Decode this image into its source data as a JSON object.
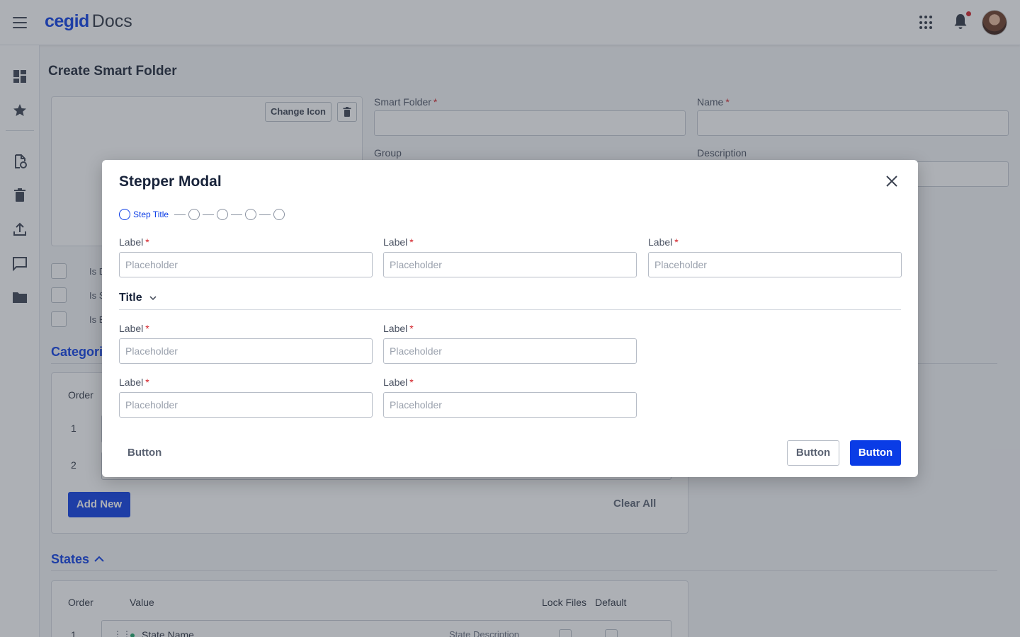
{
  "topbar": {
    "brand": "cegid",
    "app_name": "Docs",
    "icons": [
      "menu-icon",
      "apps-grid-icon",
      "bell-icon",
      "avatar"
    ],
    "notification_color": "#d32027",
    "brand_color": "#0a3ce6"
  },
  "sidebar": {
    "icons": [
      "dashboard-icon",
      "star-icon",
      "document-clock-icon",
      "trash-icon",
      "upload-icon",
      "chat-icon",
      "folder-icon"
    ]
  },
  "page": {
    "title": "Create Smart Folder",
    "change_icon_label": "Change Icon",
    "fields": {
      "smart_folder_label": "Smart Folder",
      "name_label": "Name",
      "group_label": "Group",
      "description_label": "Description"
    },
    "checkboxes": [
      "Is D",
      "Is S",
      "Is E"
    ],
    "categories": {
      "title": "Categori",
      "order_header": "Order",
      "rows": [
        "1",
        "2"
      ],
      "add_new_label": "Add New",
      "clear_all_label": "Clear All"
    },
    "states": {
      "title": "States",
      "headers": {
        "order": "Order",
        "value": "Value",
        "lock_files": "Lock Files",
        "default": "Default"
      },
      "row": {
        "order": "1",
        "name": "State Name",
        "description": "State Description"
      }
    }
  },
  "modal": {
    "title": "Stepper Modal",
    "stepper": {
      "active_step_title": "Step Title",
      "total_steps": 5,
      "active_index": 0
    },
    "row1": [
      {
        "label": "Label",
        "placeholder": "Placeholder"
      },
      {
        "label": "Label",
        "placeholder": "Placeholder"
      },
      {
        "label": "Label",
        "placeholder": "Placeholder"
      }
    ],
    "group_title": "Title",
    "row2": [
      {
        "label": "Label",
        "placeholder": "Placeholder"
      },
      {
        "label": "Label",
        "placeholder": "Placeholder"
      }
    ],
    "row3": [
      {
        "label": "Label",
        "placeholder": "Placeholder"
      },
      {
        "label": "Label",
        "placeholder": "Placeholder"
      }
    ],
    "footer": {
      "ghost_button": "Button",
      "secondary_button": "Button",
      "primary_button": "Button"
    },
    "required_marker": "*",
    "accent_color": "#0a3ce6",
    "required_color": "#d32027"
  }
}
